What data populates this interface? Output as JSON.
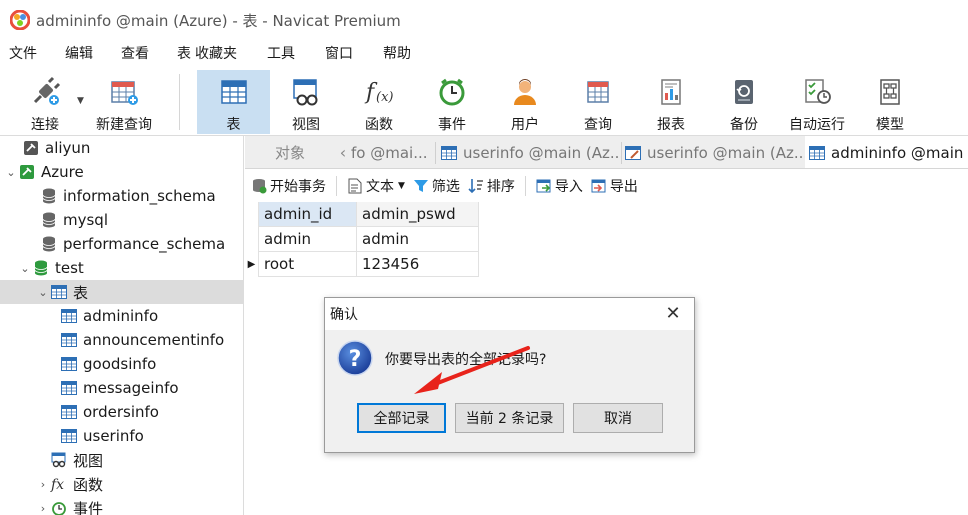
{
  "window": {
    "title": "admininfo @main (Azure) - 表 - Navicat Premium"
  },
  "menu": [
    "文件",
    "编辑",
    "查看",
    "表",
    "收藏夹",
    "工具",
    "窗口",
    "帮助"
  ],
  "toolbar": {
    "items": [
      {
        "label": "连接",
        "icon": "connect-icon"
      },
      {
        "label": "新建查询",
        "icon": "new-query-icon"
      },
      {
        "label": "表",
        "icon": "table-icon",
        "active": true
      },
      {
        "label": "视图",
        "icon": "view-icon"
      },
      {
        "label": "函数",
        "icon": "function-icon"
      },
      {
        "label": "事件",
        "icon": "event-clock-icon"
      },
      {
        "label": "用户",
        "icon": "user-icon"
      },
      {
        "label": "查询",
        "icon": "query-icon"
      },
      {
        "label": "报表",
        "icon": "report-icon"
      },
      {
        "label": "备份",
        "icon": "backup-icon"
      },
      {
        "label": "自动运行",
        "icon": "automation-icon"
      },
      {
        "label": "模型",
        "icon": "model-icon"
      }
    ]
  },
  "sidebar": {
    "items": [
      {
        "label": "aliyun",
        "icon": "connection-icon"
      },
      {
        "label": "Azure",
        "icon": "connection-icon",
        "expanded": true
      },
      {
        "label": "information_schema",
        "icon": "database-icon"
      },
      {
        "label": "mysql",
        "icon": "database-icon"
      },
      {
        "label": "performance_schema",
        "icon": "database-icon"
      },
      {
        "label": "test",
        "icon": "database-icon",
        "expanded": true
      },
      {
        "label": "表",
        "icon": "table-group-icon",
        "expanded": true,
        "selected": true
      },
      {
        "label": "admininfo",
        "icon": "table-icon"
      },
      {
        "label": "announcementinfo",
        "icon": "table-icon"
      },
      {
        "label": "goodsinfo",
        "icon": "table-icon"
      },
      {
        "label": "messageinfo",
        "icon": "table-icon"
      },
      {
        "label": "ordersinfo",
        "icon": "table-icon"
      },
      {
        "label": "userinfo",
        "icon": "table-icon"
      },
      {
        "label": "视图",
        "icon": "view-icon"
      },
      {
        "label": "函数",
        "icon": "function-icon"
      },
      {
        "label": "事件",
        "icon": "event-clock-icon"
      }
    ]
  },
  "tabs": {
    "objects": "对象",
    "t1": "fo @mai...",
    "t2": "userinfo @main (Az...",
    "t3": "userinfo @main (Az...",
    "t4": "admininfo @main ("
  },
  "subtoolbar": {
    "begin_transaction": "开始事务",
    "text": "文本",
    "filter": "筛选",
    "sort": "排序",
    "import": "导入",
    "export": "导出"
  },
  "grid": {
    "columns": [
      "admin_id",
      "admin_pswd"
    ],
    "rows": [
      [
        "admin",
        "admin"
      ],
      [
        "root",
        "123456"
      ]
    ]
  },
  "dialog": {
    "title": "确认",
    "message": "你要导出表的全部记录吗?",
    "buttons": {
      "all": "全部记录",
      "current": "当前 2 条记录",
      "cancel": "取消"
    }
  },
  "colors": {
    "accent": "#0078d7",
    "annotation_arrow": "#e8231b",
    "active_tool_bg": "#c9dff2"
  }
}
